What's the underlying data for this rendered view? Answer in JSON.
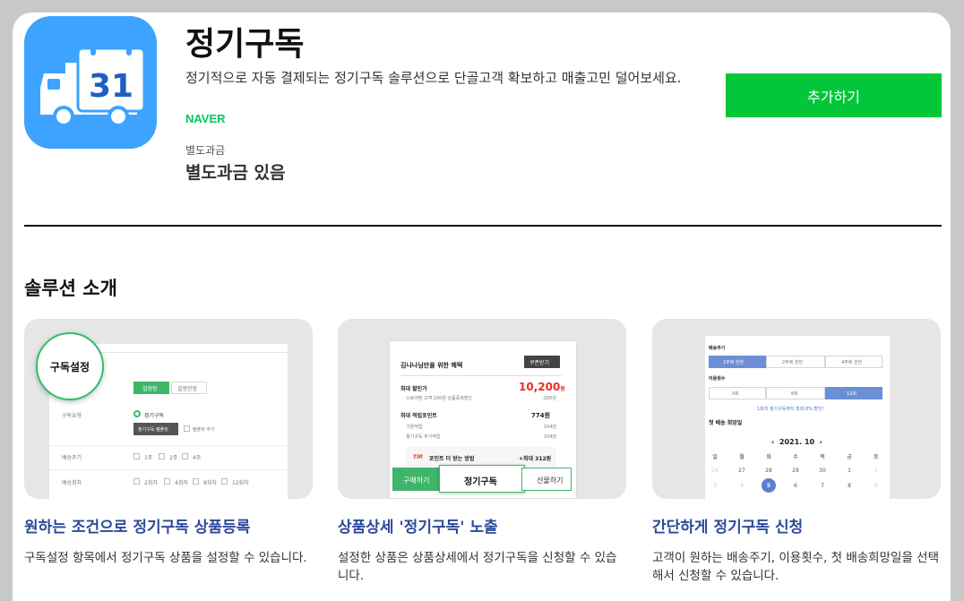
{
  "app": {
    "title": "정기구독",
    "description": "정기적으로 자동 결제되는 정기구독 솔루션으로 단골고객 확보하고 매출고민 덜어보세요.",
    "vendor": "NAVER",
    "price_label": "별도과금",
    "price_value": "별도과금 있음",
    "add_button": "추가하기",
    "icon_number": "31",
    "icon_color": "#3da3ff"
  },
  "section": {
    "title": "솔루션 소개"
  },
  "features": [
    {
      "title": "원하는 조건으로 정기구독 상품등록",
      "desc": "구독설정 항목에서 정기구독 상품을 설정할 수 있습니다.",
      "mock": {
        "badge": "구독설정",
        "tab_on": "설정함",
        "tab_off": "설정안함",
        "row1_label": "구독유형",
        "row1_radio": "정기구독",
        "row1_btn": "정기구독 템플릿",
        "row1_extra": "템플릿 추가",
        "row2_label": "배송주기",
        "row2_opts": [
          "1주",
          "2주",
          "4주"
        ],
        "row3_label": "배송회차",
        "row3_opts": [
          "2회차",
          "4회차",
          "8회차",
          "12회차"
        ]
      }
    },
    {
      "title": "상품상세 '정기구독' 노출",
      "desc": "설정한 상품은 상품상세에서 정기구독을 신청할 수 있습니다.",
      "mock": {
        "header": "김나나님만을 위한 혜택",
        "coupon": "쿠폰받기",
        "max_discount_label": "최대 할인가",
        "max_discount_value": "10,200",
        "won": "원",
        "sub1": "스토어팜 고객 200원 상품중복할인",
        "sub1_val": "-200원",
        "points_label": "최대 적립포인트",
        "points_value": "774원",
        "p1": "기본적립",
        "p1_val": "104원",
        "p2": "정기구독 추가적립",
        "p2_val": "104원",
        "tip": "TIP.",
        "tip_text": "포인트 더 받는 방법",
        "tip_val": "+최대 312원",
        "buy": "구매하기",
        "subscribe": "정기구독",
        "gift": "선물하기"
      }
    },
    {
      "title": "간단하게 정기구독 신청",
      "desc": "고객이 원하는 배송주기, 이용횟수, 첫 배송희망일을 선택해서 신청할 수 있습니다.",
      "mock": {
        "cycle_label": "배송주기",
        "cycle_opts": [
          "1주에 한번",
          "2주에 한번",
          "4주에 한번"
        ],
        "count_label": "이용횟수",
        "count_opts": [
          "4회",
          "8회",
          "12회"
        ],
        "notice": "1회차 정기구독부터 최대 8% 할인!",
        "date_label": "첫 배송 희망일",
        "month": "2021. 10",
        "weekdays": [
          "일",
          "월",
          "화",
          "수",
          "목",
          "금",
          "토"
        ],
        "week1": [
          "26",
          "27",
          "28",
          "29",
          "30",
          "1",
          "2"
        ],
        "week2": [
          "3",
          "4",
          "5",
          "6",
          "7",
          "8",
          "9"
        ]
      }
    }
  ]
}
